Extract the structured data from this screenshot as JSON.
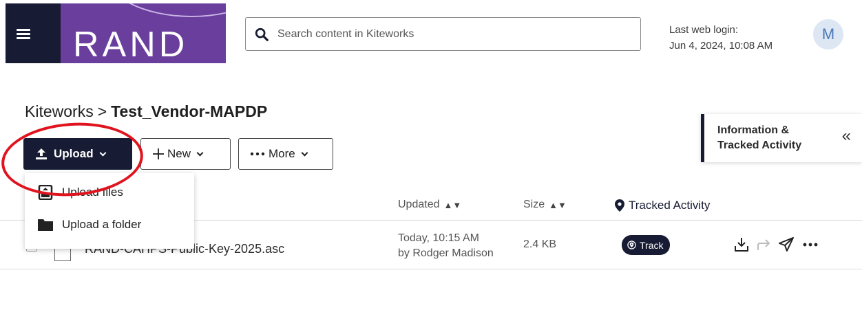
{
  "header": {
    "logo_text": "RAND",
    "search_placeholder": "Search content in Kiteworks",
    "login_label": "Last web login:",
    "login_time": "Jun 4, 2024, 10:08 AM",
    "avatar_initial": "M"
  },
  "breadcrumb": {
    "root": "Kiteworks",
    "separator": ">",
    "current": "Test_Vendor-MAPDP"
  },
  "info_panel": {
    "label": "Information & Tracked Activity",
    "collapse_glyph": "«"
  },
  "toolbar": {
    "upload_label": "Upload",
    "new_label": "New",
    "more_label": "More"
  },
  "upload_menu": {
    "items": [
      "Upload files",
      "Upload a folder"
    ]
  },
  "table": {
    "columns": {
      "updated": "Updated",
      "size": "Size",
      "tracked": "Tracked Activity"
    },
    "rows": [
      {
        "name": "RAND-CAHPS-Public-Key-2025.asc",
        "updated": "Today, 10:15 AM",
        "updated_by": "by Rodger Madison",
        "size": "2.4 KB",
        "track_label": "Track"
      }
    ]
  },
  "colors": {
    "navy": "#171b33",
    "brand_purple": "#6a3e9c",
    "annotation_red": "#e0141e"
  },
  "icons": [
    "menu-icon",
    "search-icon",
    "upload-icon",
    "plus-icon",
    "ellipsis-icon",
    "chevron-down-icon",
    "file-upload-icon",
    "folder-icon",
    "location-pin-icon",
    "download-icon",
    "share-icon",
    "send-icon",
    "more-icon",
    "double-chevron-left-icon"
  ]
}
